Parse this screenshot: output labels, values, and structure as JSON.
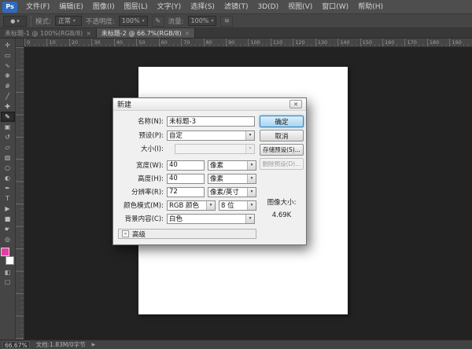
{
  "colors": {
    "accent_blue": "#3a80b5",
    "foreground_swatch": "#e83aa3",
    "background_swatch": "#ffffff",
    "ui_dark": "#454545",
    "canvas": "#222222"
  },
  "icons": {
    "dropdown_arrow": "▾",
    "disclosure": "»",
    "close": "✕",
    "tab_close": "×",
    "pen_pressure": "✎",
    "airbrush": "≋",
    "status_expander": "▶",
    "brush_preview": "●"
  },
  "menu_bar": {
    "logo": "Ps",
    "items": [
      {
        "name": "menu-file",
        "label": "文件(F)"
      },
      {
        "name": "menu-edit",
        "label": "编辑(E)"
      },
      {
        "name": "menu-image",
        "label": "图像(I)"
      },
      {
        "name": "menu-layer",
        "label": "图层(L)"
      },
      {
        "name": "menu-type",
        "label": "文字(Y)"
      },
      {
        "name": "menu-select",
        "label": "选择(S)"
      },
      {
        "name": "menu-filter",
        "label": "滤镜(T)"
      },
      {
        "name": "menu-3d",
        "label": "3D(D)"
      },
      {
        "name": "menu-view",
        "label": "视图(V)"
      },
      {
        "name": "menu-window",
        "label": "窗口(W)"
      },
      {
        "name": "menu-help",
        "label": "帮助(H)"
      }
    ]
  },
  "options_bar": {
    "mode_label": "模式:",
    "mode_value": "正常",
    "opacity_label": "不透明度:",
    "opacity_value": "100%",
    "flow_label": "流量:",
    "flow_value": "100%"
  },
  "tabs": [
    {
      "name": "tab-untitled-1",
      "label": "未标题-1 @ 100%(RGB/8)",
      "close": "×",
      "active": false
    },
    {
      "name": "tab-untitled-2",
      "label": "未标题-2 @ 66.7%(RGB/8)",
      "close": "×",
      "active": true
    }
  ],
  "ruler": {
    "h_labels": [
      "0",
      "10",
      "20",
      "30",
      "40",
      "50",
      "60",
      "70",
      "80",
      "90",
      "100",
      "110",
      "120",
      "130",
      "140",
      "150",
      "160",
      "170",
      "180",
      "190"
    ]
  },
  "toolbar": {
    "tools": [
      {
        "name": "move-tool",
        "glyph": "✛"
      },
      {
        "name": "rectangular-marquee-tool",
        "glyph": "▭"
      },
      {
        "name": "lasso-tool",
        "glyph": "∿"
      },
      {
        "name": "quick-selection-tool",
        "glyph": "❋"
      },
      {
        "name": "crop-tool",
        "glyph": "#"
      },
      {
        "name": "eyedropper-tool",
        "glyph": "╱"
      },
      {
        "name": "healing-brush-tool",
        "glyph": "✚"
      },
      {
        "name": "brush-tool",
        "glyph": "✎",
        "active": true
      },
      {
        "name": "clone-stamp-tool",
        "glyph": "▣"
      },
      {
        "name": "history-brush-tool",
        "glyph": "↺"
      },
      {
        "name": "eraser-tool",
        "glyph": "▱"
      },
      {
        "name": "gradient-tool",
        "glyph": "▨"
      },
      {
        "name": "blur-tool",
        "glyph": "○"
      },
      {
        "name": "dodge-tool",
        "glyph": "◐"
      },
      {
        "name": "pen-tool",
        "glyph": "✒"
      },
      {
        "name": "type-tool",
        "glyph": "T"
      },
      {
        "name": "path-selection-tool",
        "glyph": "▶"
      },
      {
        "name": "shape-tool",
        "glyph": "■"
      },
      {
        "name": "hand-tool",
        "glyph": "☛"
      },
      {
        "name": "zoom-tool",
        "glyph": "◎"
      }
    ],
    "bottom_tools": [
      {
        "name": "quick-mask-button",
        "glyph": "◧"
      },
      {
        "name": "screen-mode-button",
        "glyph": "▢"
      }
    ]
  },
  "dialog": {
    "title": "新建",
    "fields": {
      "name_label": "名称(N):",
      "name_value": "未标题-3",
      "preset_label": "预设(P):",
      "preset_value": "自定",
      "size_label": "大小(I):",
      "size_value": "",
      "width_label": "宽度(W):",
      "width_value": "40",
      "width_unit": "像素",
      "height_label": "高度(H):",
      "height_value": "40",
      "height_unit": "像素",
      "resolution_label": "分辨率(R):",
      "resolution_value": "72",
      "resolution_unit": "像素/英寸",
      "color_mode_label": "颜色模式(M):",
      "color_mode_value": "RGB 颜色",
      "bit_depth_value": "8 位",
      "background_label": "背景内容(C):",
      "background_value": "白色"
    },
    "buttons": {
      "ok": "确定",
      "cancel": "取消",
      "save_preset": "存储预设(S)...",
      "delete_preset": "删除预设(D)..."
    },
    "image_size_label": "图像大小:",
    "image_size_value": "4.69K",
    "advanced_label": "高级"
  },
  "status_bar": {
    "zoom": "66.67%",
    "doc_info": "文档:1.83M/0字节"
  }
}
